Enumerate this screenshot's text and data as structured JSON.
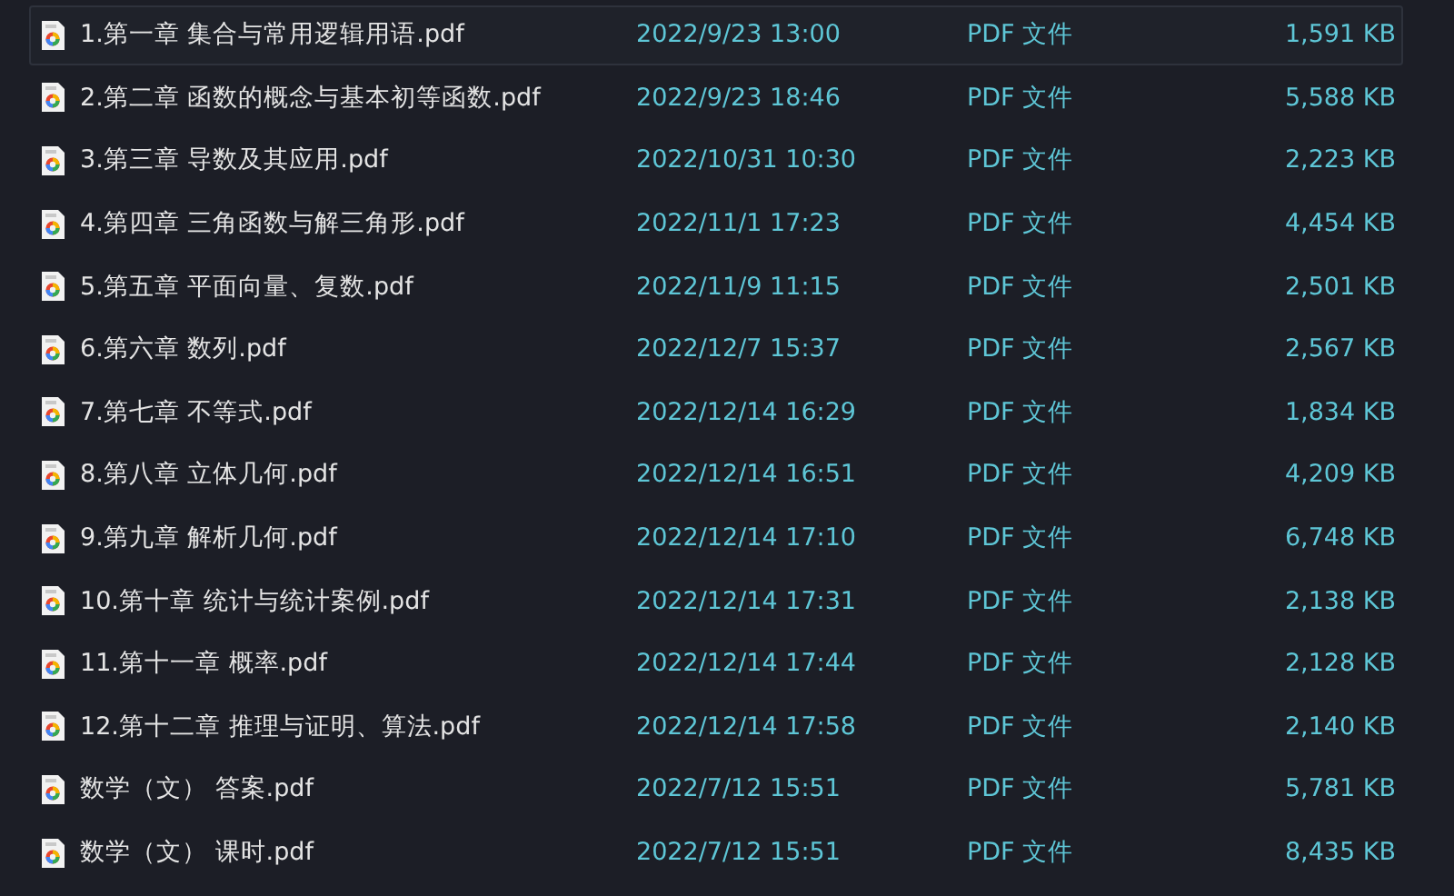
{
  "files": [
    {
      "name": "1.第一章 集合与常用逻辑用语.pdf",
      "modified": "2022/9/23 13:00",
      "type": "PDF 文件",
      "size": "1,591 KB",
      "focused": true
    },
    {
      "name": "2.第二章 函数的概念与基本初等函数.pdf",
      "modified": "2022/9/23 18:46",
      "type": "PDF 文件",
      "size": "5,588 KB",
      "focused": false
    },
    {
      "name": "3.第三章 导数及其应用.pdf",
      "modified": "2022/10/31 10:30",
      "type": "PDF 文件",
      "size": "2,223 KB",
      "focused": false
    },
    {
      "name": "4.第四章 三角函数与解三角形.pdf",
      "modified": "2022/11/1 17:23",
      "type": "PDF 文件",
      "size": "4,454 KB",
      "focused": false
    },
    {
      "name": "5.第五章 平面向量、复数.pdf",
      "modified": "2022/11/9 11:15",
      "type": "PDF 文件",
      "size": "2,501 KB",
      "focused": false
    },
    {
      "name": "6.第六章 数列.pdf",
      "modified": "2022/12/7 15:37",
      "type": "PDF 文件",
      "size": "2,567 KB",
      "focused": false
    },
    {
      "name": "7.第七章 不等式.pdf",
      "modified": "2022/12/14 16:29",
      "type": "PDF 文件",
      "size": "1,834 KB",
      "focused": false
    },
    {
      "name": "8.第八章 立体几何.pdf",
      "modified": "2022/12/14 16:51",
      "type": "PDF 文件",
      "size": "4,209 KB",
      "focused": false
    },
    {
      "name": "9.第九章 解析几何.pdf",
      "modified": "2022/12/14 17:10",
      "type": "PDF 文件",
      "size": "6,748 KB",
      "focused": false
    },
    {
      "name": "10.第十章 统计与统计案例.pdf",
      "modified": "2022/12/14 17:31",
      "type": "PDF 文件",
      "size": "2,138 KB",
      "focused": false
    },
    {
      "name": "11.第十一章 概率.pdf",
      "modified": "2022/12/14 17:44",
      "type": "PDF 文件",
      "size": "2,128 KB",
      "focused": false
    },
    {
      "name": "12.第十二章 推理与证明、算法.pdf",
      "modified": "2022/12/14 17:58",
      "type": "PDF 文件",
      "size": "2,140 KB",
      "focused": false
    },
    {
      "name": "数学（文） 答案.pdf",
      "modified": "2022/7/12 15:51",
      "type": "PDF 文件",
      "size": "5,781 KB",
      "focused": false
    },
    {
      "name": "数学（文） 课时.pdf",
      "modified": "2022/7/12 15:51",
      "type": "PDF 文件",
      "size": "8,435 KB",
      "focused": false
    }
  ]
}
